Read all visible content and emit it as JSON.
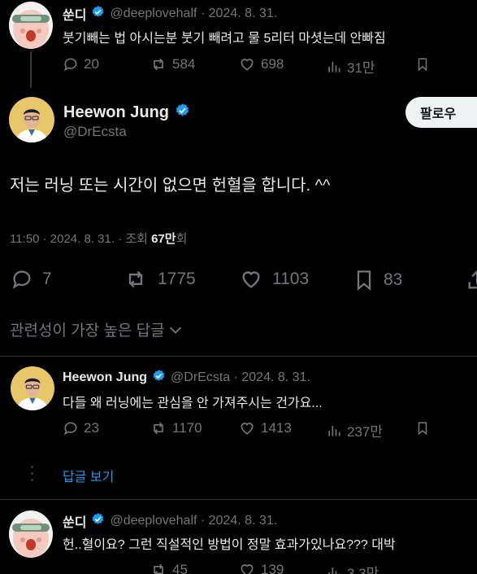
{
  "tweet_top": {
    "display_name": "쑨디",
    "handle_date": "@deeplovehalf · 2024. 8. 31.",
    "text": "붓기빼는 법 아시는분 붓기 빼려고 물 5리터 마셧는데 안빠짐",
    "replies": "20",
    "retweets": "584",
    "likes": "698",
    "views": "31만"
  },
  "main_tweet": {
    "display_name": "Heewon Jung",
    "handle": "@DrEcsta",
    "follow_label": "팔로우",
    "text": "저는 러닝 또는 시간이 없으면 헌혈을 합니다. ^^",
    "meta_time": "11:50 · 2024. 8. 31. · 조회 ",
    "meta_views": "67만",
    "meta_suffix": "회",
    "replies": "7",
    "retweets": "1775",
    "likes": "1103",
    "bookmarks": "83"
  },
  "sort_label": "관련성이 가장 높은 답글",
  "reply_1": {
    "display_name": "Heewon Jung",
    "handle_date": "@DrEcsta · 2024. 8. 31.",
    "text": "다들 왜 러닝에는 관심을 안 가져주시는 건가요...",
    "replies": "23",
    "retweets": "1170",
    "likes": "1413",
    "views": "237만",
    "show_replies": "답글 보기"
  },
  "reply_2": {
    "display_name": "쑨디",
    "handle_date": "@deeplovehalf · 2024. 8. 31.",
    "text": "헌..혈이요? 그런 직설적인 방법이 정말 효과가있나요??? 대박",
    "retweets": "45",
    "likes": "139",
    "views": "3.3만"
  },
  "colors": {
    "background": "#000000",
    "text": "#e7e9ea",
    "muted": "#71767b",
    "accent": "#1d9bf0",
    "divider": "#2f3336"
  },
  "icons": [
    "verified-badge-icon",
    "reply-icon",
    "retweet-icon",
    "like-icon",
    "views-icon",
    "bookmark-icon",
    "share-icon",
    "chevron-down-icon"
  ]
}
